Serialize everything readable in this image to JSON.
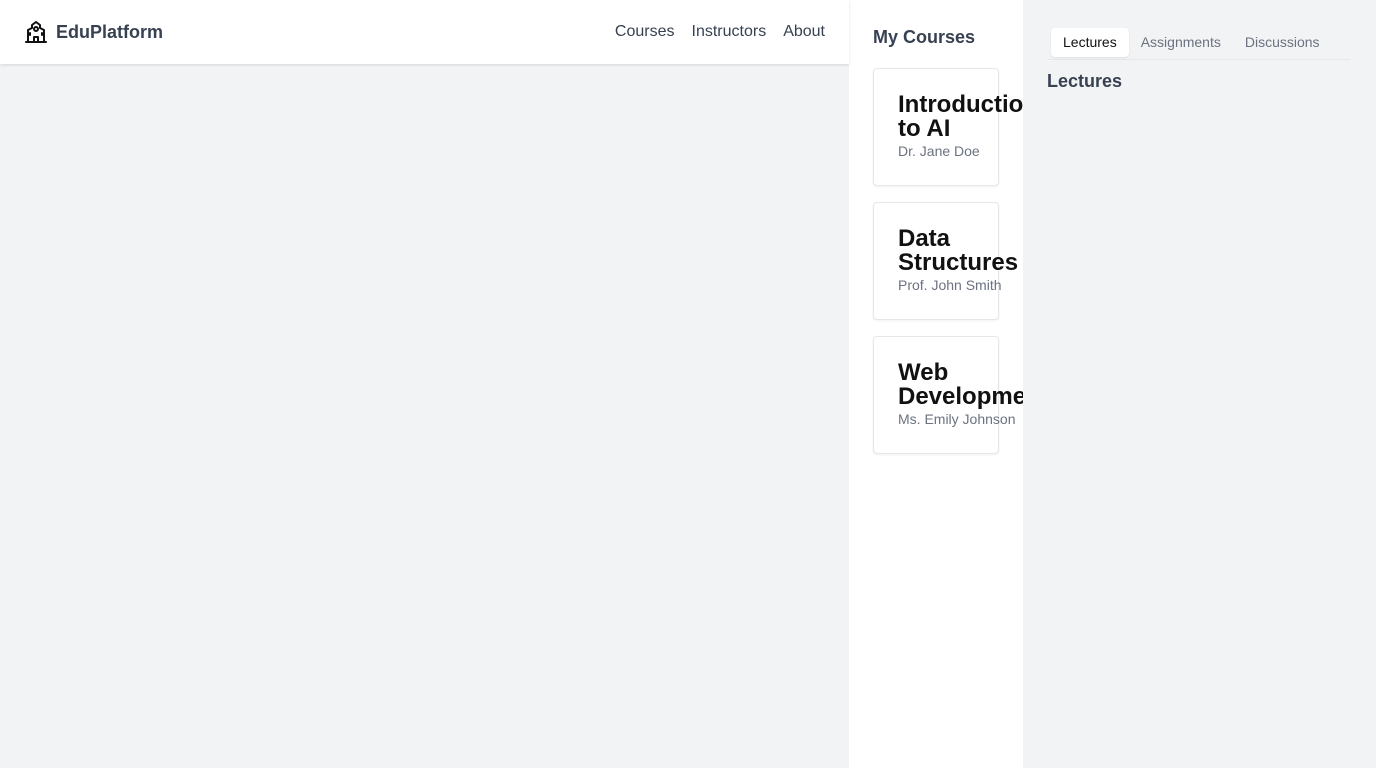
{
  "header": {
    "brand_name": "EduPlatform",
    "brand_icon": "school-building-icon",
    "nav": [
      "Courses",
      "Instructors",
      "About"
    ]
  },
  "courses_panel": {
    "title": "My Courses",
    "courses": [
      {
        "name": "Introduction to AI",
        "instructor": "Dr. Jane Doe"
      },
      {
        "name": "Data Structures",
        "instructor": "Prof. John Smith"
      },
      {
        "name": "Web Development",
        "instructor": "Ms. Emily Johnson"
      }
    ]
  },
  "detail_panel": {
    "tabs": [
      "Lectures",
      "Assignments",
      "Discussions"
    ],
    "active_tab": "Lectures",
    "section_heading": "Lectures"
  },
  "colors": {
    "page_background": "#f2f3f5",
    "panel_background": "#ffffff",
    "text_primary": "#374151",
    "text_muted": "#6b7280"
  }
}
